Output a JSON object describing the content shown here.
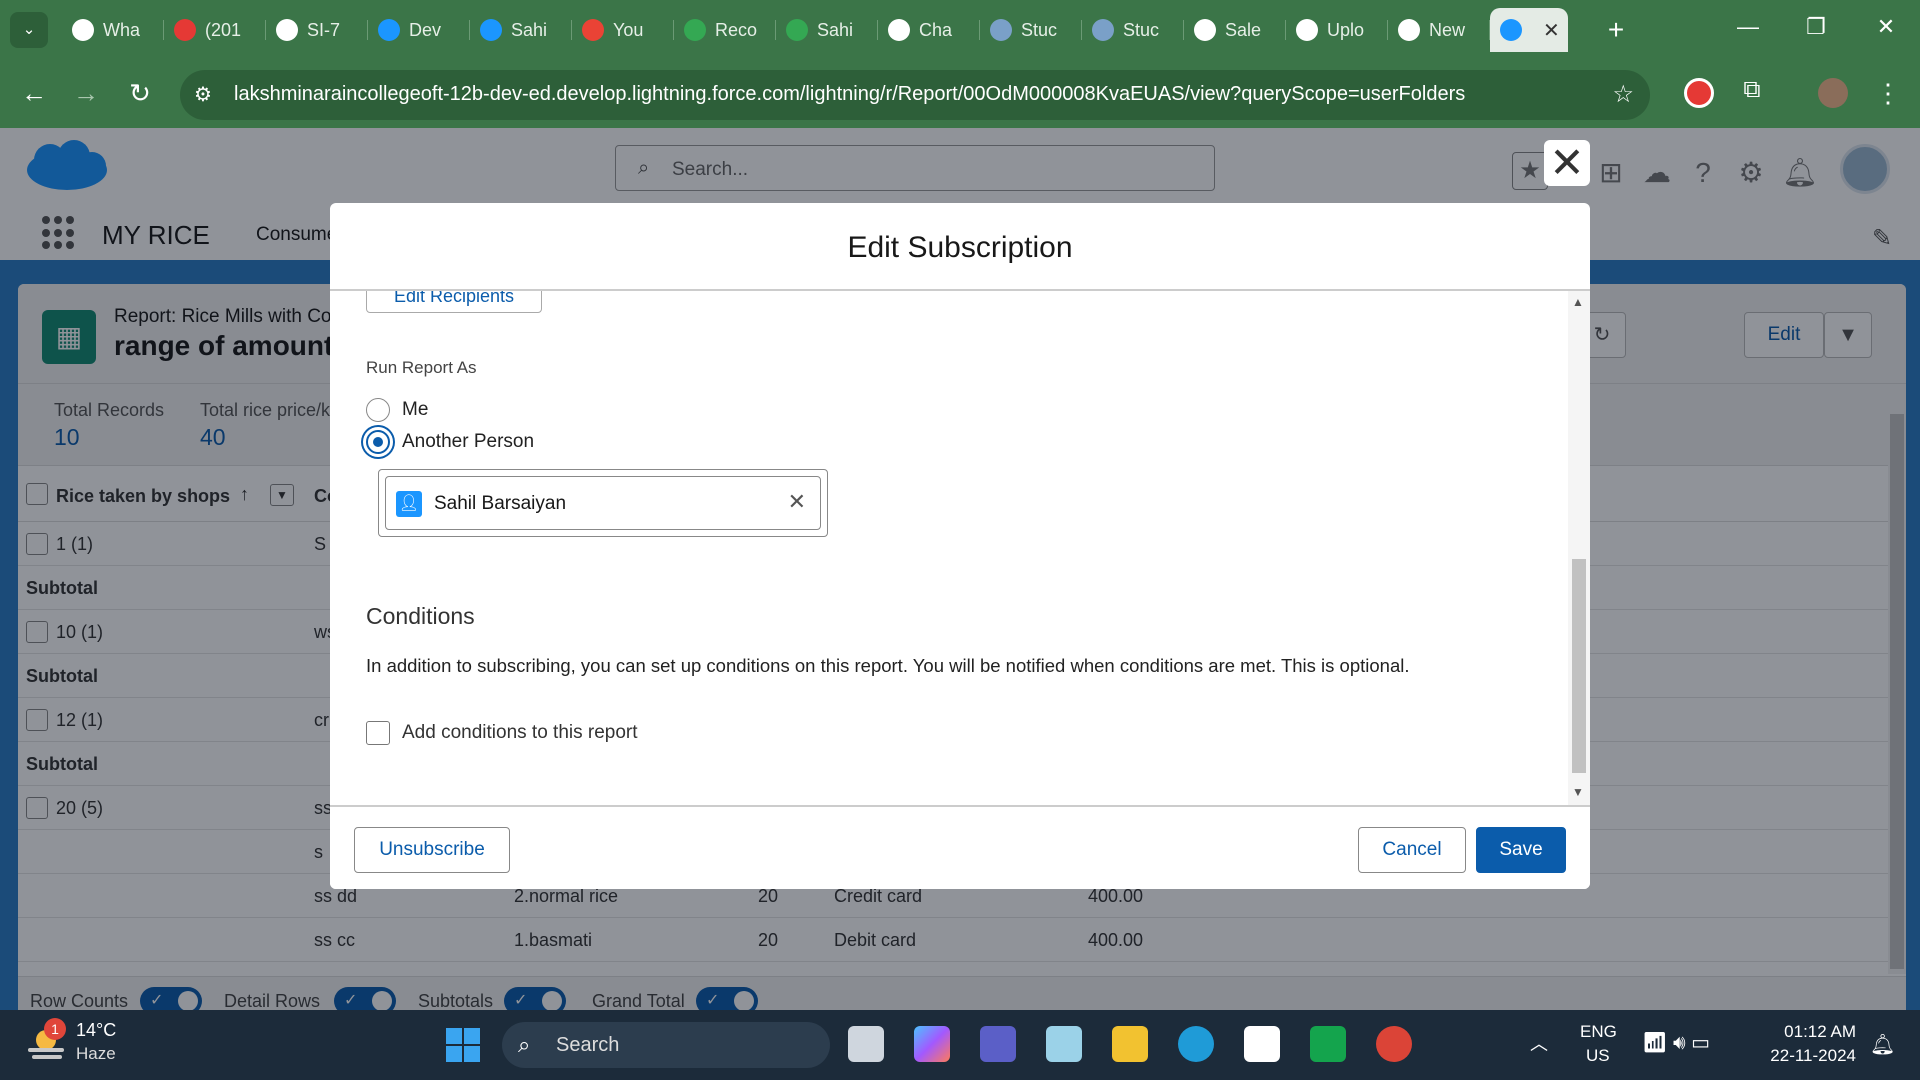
{
  "browser": {
    "tabs": [
      {
        "label": "Wha",
        "color": "#ffffff"
      },
      {
        "label": "(201",
        "color": "#e53935"
      },
      {
        "label": "SI-7",
        "color": "#ffffff"
      },
      {
        "label": "Dev",
        "color": "#1b96ff"
      },
      {
        "label": "Sahi",
        "color": "#1b96ff"
      },
      {
        "label": "You",
        "color": "#ea4335"
      },
      {
        "label": "Reco",
        "color": "#34a853"
      },
      {
        "label": "Sahi",
        "color": "#34a853"
      },
      {
        "label": "Cha",
        "color": "#ffffff"
      },
      {
        "label": "Stuc",
        "color": "#7aa0c8"
      },
      {
        "label": "Stuc",
        "color": "#7aa0c8"
      },
      {
        "label": "Sale",
        "color": "#ffffff"
      },
      {
        "label": "Uplo",
        "color": "#ffffff"
      },
      {
        "label": "New",
        "color": "#ffffff"
      }
    ],
    "active_tab_color": "#1b96ff",
    "url": "lakshminaraincollegeoft-12b-dev-ed.develop.lightning.force.com/lightning/r/Report/00OdM000008KvaEUAS/view?queryScope=userFolders"
  },
  "sf": {
    "search_placeholder": "Search...",
    "app_name": "MY RICE",
    "nav_item": "Consume"
  },
  "report": {
    "subtitle": "Report: Rice Mills with Co",
    "title": "range of amount",
    "edit_label": "Edit",
    "stats": [
      {
        "label": "Total Records",
        "value": "10"
      },
      {
        "label": "Total rice price/k",
        "value": "40"
      }
    ],
    "group_column": "Rice taken by shops",
    "col2": "Co",
    "rows": [
      {
        "group": "1 (1)",
        "c2": "S"
      },
      {
        "subtotal": "Subtotal"
      },
      {
        "group": "10 (1)",
        "c2": "ws"
      },
      {
        "subtotal": "Subtotal"
      },
      {
        "group": "12 (1)",
        "c2": "cr"
      },
      {
        "subtotal": "Subtotal"
      },
      {
        "group": "20 (5)",
        "c2": "ss"
      }
    ],
    "detail_rows": [
      {
        "c2": "s",
        "c3": "",
        "c4": "",
        "c5": "",
        "c6": ""
      },
      {
        "c2": "ss dd",
        "c3": "2.normal rice",
        "c4": "20",
        "c5": "Credit card",
        "c6": "400.00"
      },
      {
        "c2": "ss cc",
        "c3": "1.basmati",
        "c4": "20",
        "c5": "Debit card",
        "c6": "400.00"
      }
    ],
    "footer": {
      "row_counts": "Row Counts",
      "detail_rows": "Detail Rows",
      "subtotals": "Subtotals",
      "grand_total": "Grand Total"
    }
  },
  "modal": {
    "title": "Edit Subscription",
    "edit_recipients": "Edit Recipients",
    "run_as_label": "Run Report As",
    "option_me": "Me",
    "option_another": "Another Person",
    "selected_person": "Sahil Barsaiyan",
    "conditions_title": "Conditions",
    "conditions_desc": "In addition to subscribing, you can set up conditions on this report. You will be notified when conditions are met. This is optional.",
    "add_conditions_label": "Add conditions to this report",
    "unsubscribe": "Unsubscribe",
    "cancel": "Cancel",
    "save": "Save"
  },
  "taskbar": {
    "notification_count": "1",
    "temperature": "14°C",
    "weather": "Haze",
    "search_label": "Search",
    "lang_line1": "ENG",
    "lang_line2": "US",
    "time": "01:12 AM",
    "date": "22-11-2024"
  }
}
